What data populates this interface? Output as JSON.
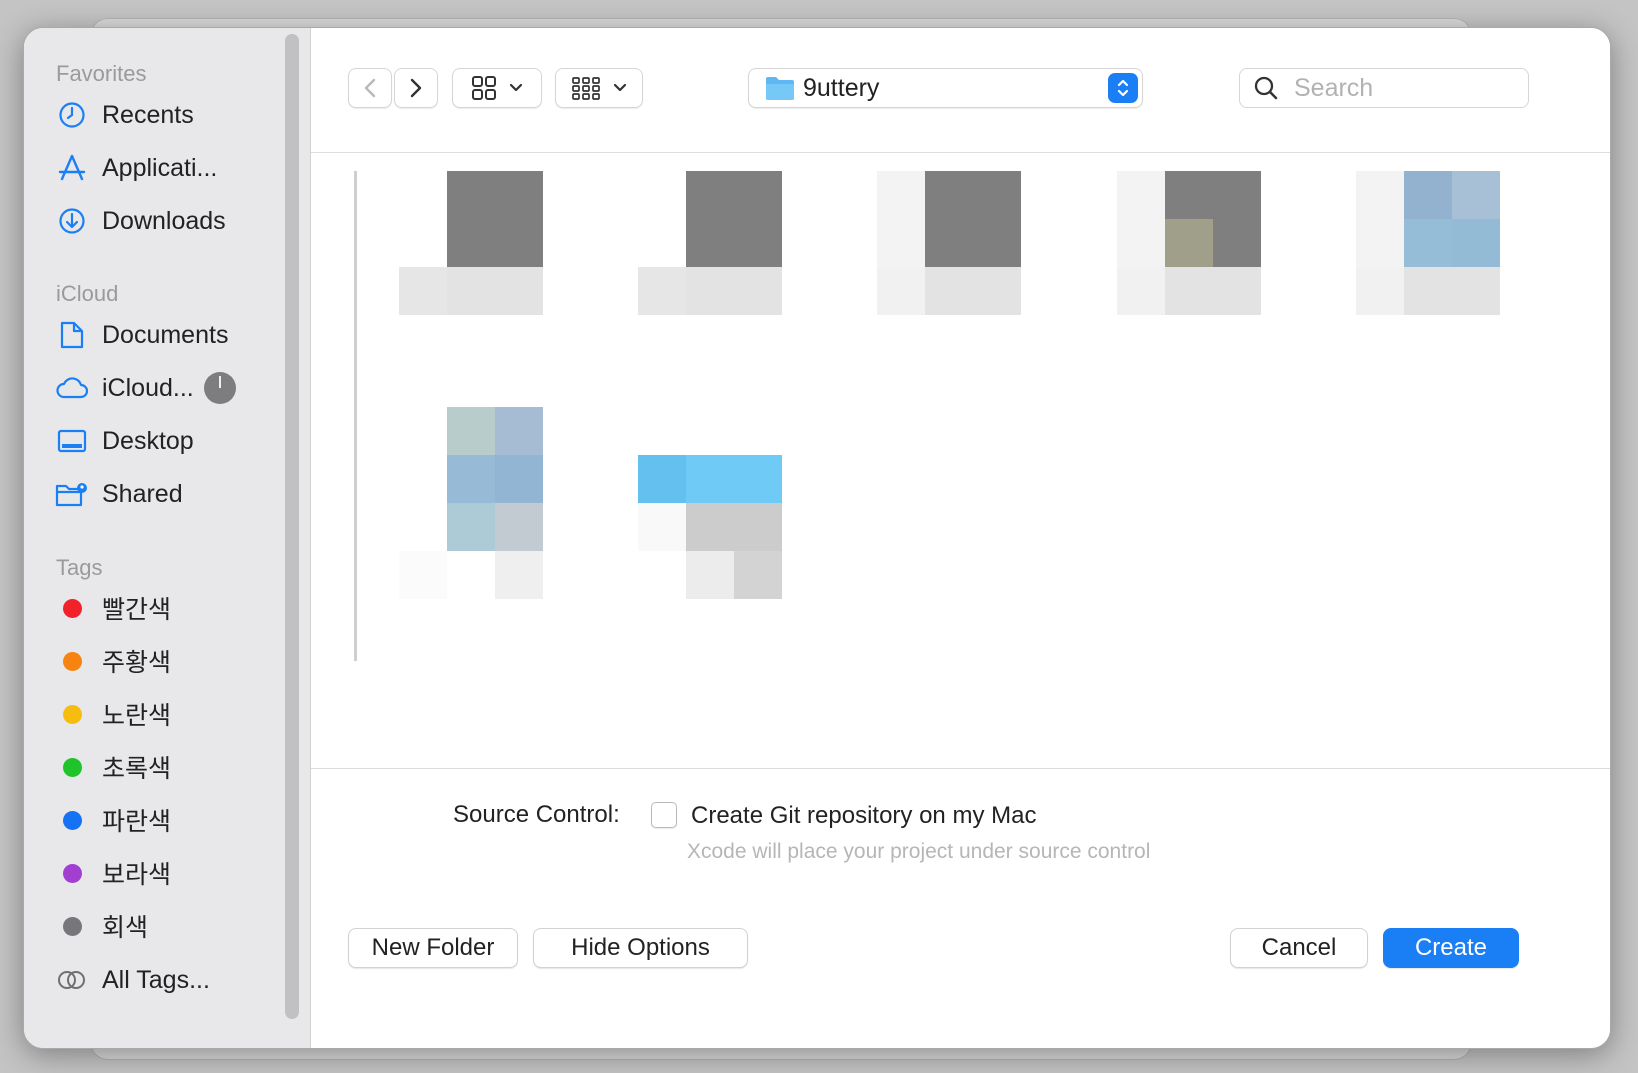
{
  "sidebar": {
    "favorites_header": "Favorites",
    "favorites": [
      {
        "label": "Recents",
        "icon": "clock-icon"
      },
      {
        "label": "Applicati...",
        "icon": "applications-icon"
      },
      {
        "label": "Downloads",
        "icon": "download-icon"
      }
    ],
    "icloud_header": "iCloud",
    "icloud": [
      {
        "label": "Documents",
        "icon": "document-icon"
      },
      {
        "label": "iCloud...",
        "icon": "cloud-icon"
      },
      {
        "label": "Desktop",
        "icon": "desktop-icon"
      },
      {
        "label": "Shared",
        "icon": "shared-folder-icon"
      }
    ],
    "tags_header": "Tags",
    "tags": [
      {
        "label": "빨간색",
        "color": "#f2222b"
      },
      {
        "label": "주황색",
        "color": "#f78410"
      },
      {
        "label": "노란색",
        "color": "#f6bd10"
      },
      {
        "label": "초록색",
        "color": "#1ec42a"
      },
      {
        "label": "파란색",
        "color": "#1572f5"
      },
      {
        "label": "보라색",
        "color": "#a33fd0"
      },
      {
        "label": "회색",
        "color": "#77777b"
      }
    ],
    "all_tags": "All Tags..."
  },
  "toolbar": {
    "folder_name": "9uttery",
    "search_placeholder": "Search"
  },
  "browser": {
    "thumbnail_count": 7
  },
  "options": {
    "source_control_label": "Source Control:",
    "git_checkbox_label": "Create Git repository on my Mac",
    "git_checked": false,
    "hint": "Xcode will place your project under source control"
  },
  "footer": {
    "new_folder": "New Folder",
    "hide_options": "Hide Options",
    "cancel": "Cancel",
    "create": "Create"
  },
  "colors": {
    "accent": "#1a7ff5"
  }
}
